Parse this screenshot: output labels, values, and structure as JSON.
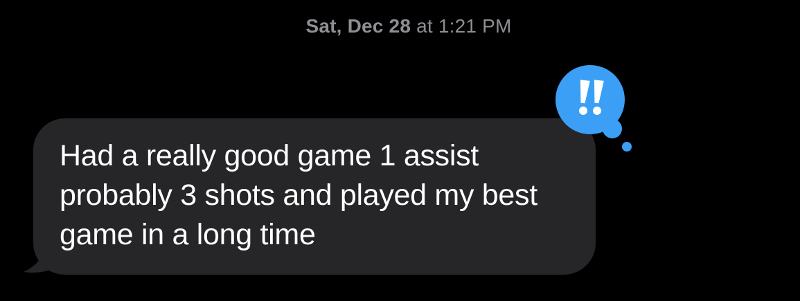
{
  "conversation": {
    "timestamp": {
      "day": "Sat, Dec 28",
      "time": "at 1:21 PM"
    },
    "message": {
      "direction": "incoming",
      "text": "Had a really good game 1 assist probably 3 shots and played my best game in a long time",
      "bubble_color": "#262628",
      "text_color": "#ffffff"
    },
    "tapback": {
      "icon": "double-exclamation-icon",
      "label": "!!",
      "color": "#3ba0f5"
    }
  }
}
